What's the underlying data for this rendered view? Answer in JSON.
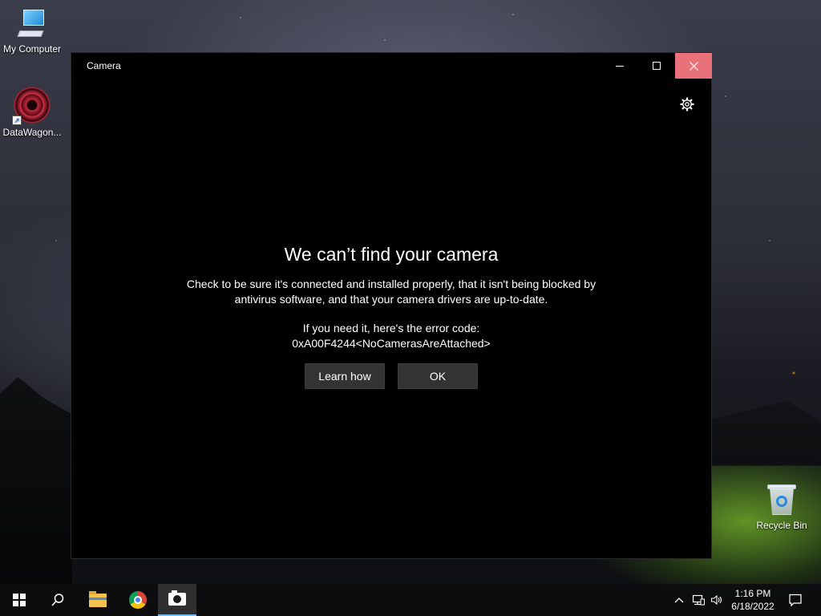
{
  "desktop": {
    "icons": [
      {
        "label": "My Computer",
        "icon": "computer-icon"
      },
      {
        "label": "DataWagon...",
        "icon": "datawagon-icon"
      },
      {
        "label": "Recycle Bin",
        "icon": "recycle-bin-icon"
      }
    ]
  },
  "window": {
    "title": "Camera",
    "controls": {
      "minimize": "minimize-icon",
      "maximize": "maximize-icon",
      "close": "close-icon"
    },
    "settings_icon": "gear-icon",
    "error": {
      "heading": "We can’t find your camera",
      "body": "Check to be sure it's connected and installed properly, that it isn't being blocked by antivirus software, and that your camera drivers are up-to-date.",
      "code_prompt": "If you need it, here's the error code:",
      "code": "0xA00F4244<NoCamerasAreAttached>"
    },
    "buttons": {
      "learn_how": "Learn how",
      "ok": "OK"
    }
  },
  "taskbar": {
    "items": [
      "start-icon",
      "search-icon",
      "file-explorer-icon",
      "chrome-icon",
      "camera-icon"
    ],
    "active_item": "camera-icon",
    "tray": [
      "chevron-up-icon",
      "network-icon",
      "volume-icon"
    ],
    "clock": {
      "time": "1:16 PM",
      "date": "6/18/2022"
    },
    "notification_icon": "notification-icon"
  },
  "colors": {
    "close_button_bg": "#e8717a",
    "button_bg": "#333333",
    "window_bg": "#000000",
    "active_indicator": "#76b9ed"
  }
}
